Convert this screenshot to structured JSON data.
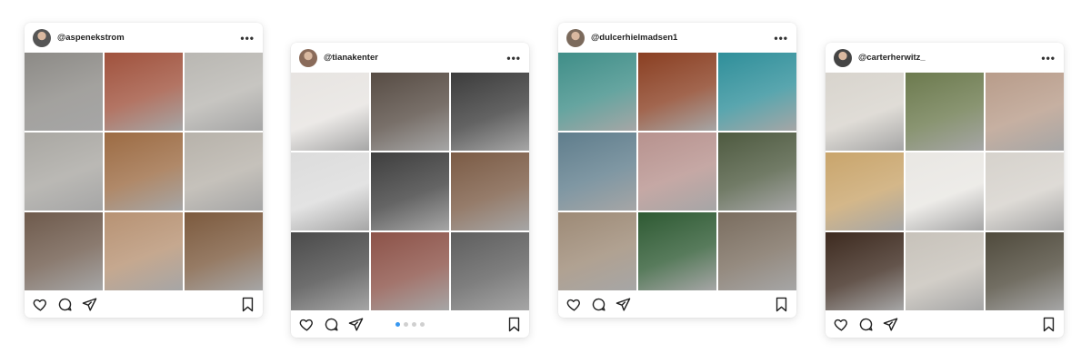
{
  "posts": [
    {
      "username": "@aspenekstrom",
      "more_label": "•••",
      "avatar_color": "#555555",
      "photo_colors": [
        "#8c8a86",
        "#a0523d",
        "#b9b7b2",
        "#a9a7a2",
        "#9c6b43",
        "#b7b2aa",
        "#6e5a4c",
        "#b79273",
        "#7c5a3e"
      ]
    },
    {
      "username": "@tianakenter",
      "more_label": "•••",
      "avatar_color": "#8a6b5a",
      "photo_colors": [
        "#e7e4e1",
        "#574c44",
        "#3c3c3c",
        "#dcdcdc",
        "#3e3e3e",
        "#7b5b45",
        "#4a4a4a",
        "#8c5248",
        "#5e5e5e"
      ],
      "carousel": {
        "count": 4,
        "active": 0
      }
    },
    {
      "username": "@dulcerhielmadsen1",
      "more_label": "•••",
      "avatar_color": "#7b6a5c",
      "photo_colors": [
        "#3f8e88",
        "#8a3f22",
        "#2f8f9a",
        "#5f7d8c",
        "#b7928e",
        "#4e5a40",
        "#9d8a76",
        "#2e5a33",
        "#7a6d5f"
      ]
    },
    {
      "username": "@carterherwitz_",
      "more_label": "•••",
      "avatar_color": "#444444",
      "photo_colors": [
        "#d8d4cd",
        "#6c7a4e",
        "#b89c8a",
        "#c9a56c",
        "#e9e7e3",
        "#d6d2cc",
        "#3d2a1f",
        "#c7c2ba",
        "#4f4a3c"
      ]
    }
  ]
}
